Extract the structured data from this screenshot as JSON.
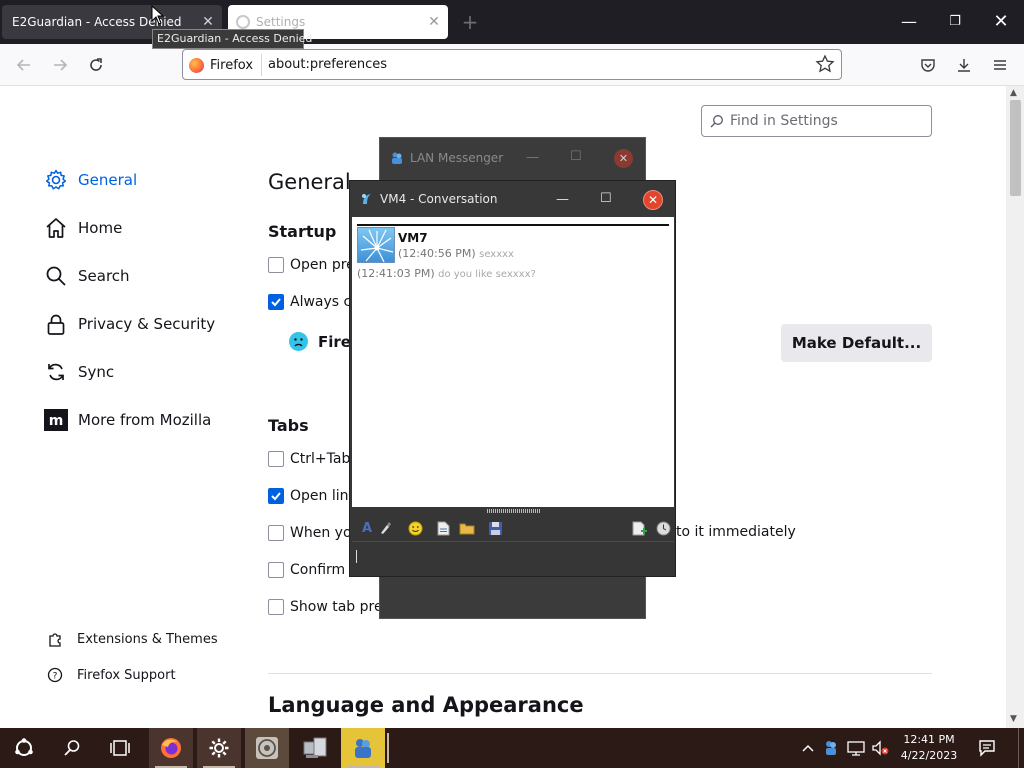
{
  "browser": {
    "tabs": [
      {
        "label": "E2Guardian - Access Denied",
        "active": true
      },
      {
        "label": "Settings",
        "active": false
      }
    ],
    "tab_tooltip": "E2Guardian - Access Denied",
    "new_tab_label": "+",
    "window_controls": {
      "minimize": "—",
      "maximize": "❐",
      "close": "✕"
    },
    "url_identity": "Firefox",
    "url": "about:preferences"
  },
  "settings": {
    "search_placeholder": "Find in Settings",
    "categories": [
      {
        "label": "General",
        "icon": "gear-icon",
        "selected": true
      },
      {
        "label": "Home",
        "icon": "home-icon"
      },
      {
        "label": "Search",
        "icon": "search-icon"
      },
      {
        "label": "Privacy & Security",
        "icon": "lock-icon"
      },
      {
        "label": "Sync",
        "icon": "sync-icon"
      },
      {
        "label": "More from Mozilla",
        "icon": "mozilla-icon"
      }
    ],
    "footer_links": [
      {
        "label": "Extensions & Themes",
        "icon": "puzzle-icon"
      },
      {
        "label": "Firefox Support",
        "icon": "help-icon"
      }
    ],
    "heading": "General",
    "startup": {
      "heading": "Startup",
      "open_previous": {
        "label": "Open pre",
        "checked": false
      },
      "always_check": {
        "label": "Always ch",
        "checked": true
      },
      "default_status": "Firef",
      "make_default_button": "Make Default..."
    },
    "tabs_section": {
      "heading": "Tabs",
      "items": [
        {
          "label": "Ctrl+Tab",
          "checked": false
        },
        {
          "label": "Open link",
          "checked": true
        },
        {
          "label": "When yo",
          "checked": false
        },
        {
          "label": "Confirm b",
          "checked": false
        },
        {
          "label": "Show tab prev",
          "checked": false
        }
      ],
      "when_you_suffix": "to it immediately"
    },
    "language_heading": "Language and Appearance"
  },
  "lan_messenger": {
    "title": "LAN Messenger",
    "controls": {
      "minimize": "—",
      "maximize": "☐",
      "close": "✕"
    }
  },
  "conversation": {
    "title": "VM4 - Conversation",
    "controls": {
      "minimize": "—",
      "maximize": "☐",
      "close": "✕"
    },
    "sender": "VM7",
    "messages": [
      {
        "time": "(12:40:56 PM)",
        "text": "sexxxx"
      },
      {
        "time": "(12:41:03 PM)",
        "text": "do you like sexxxx?"
      }
    ],
    "tools_left": [
      "font-icon",
      "brush-icon",
      "smiley-icon",
      "file-icon",
      "folder-icon",
      "save-icon"
    ],
    "tools_right": [
      "add-note-icon",
      "history-icon"
    ]
  },
  "taskbar": {
    "time": "12:41 PM",
    "date": "4/22/2023",
    "apps": [
      "firefox-icon",
      "settings-icon",
      "disk-icon",
      "computer-icon",
      "lan-messenger-icon"
    ]
  },
  "colors": {
    "accent": "#0061e0",
    "close_red": "#e1452d",
    "taskbar": "#2b1a16"
  }
}
